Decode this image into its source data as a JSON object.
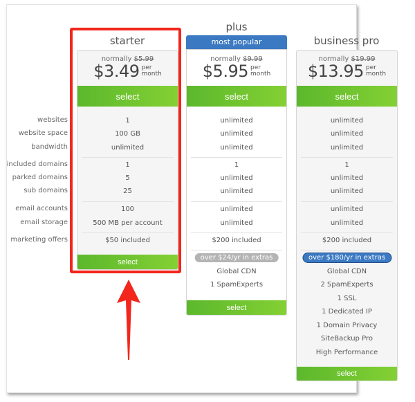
{
  "feature_labels": [
    "websites",
    "website space",
    "bandwidth",
    "included domains",
    "parked domains",
    "sub domains",
    "email accounts",
    "email storage",
    "marketing offers"
  ],
  "plans": [
    {
      "name": "starter",
      "badge": "",
      "normally_label": "normally",
      "old_price": "$5.99",
      "price": "$3.49",
      "per": "per",
      "period": "month",
      "select_label": "select",
      "features": [
        "1",
        "100 GB",
        "unlimited",
        "1",
        "5",
        "25",
        "100",
        "500 MB per account",
        "$50 included"
      ],
      "extras_pill": "",
      "extras": []
    },
    {
      "name": "plus",
      "badge": "most popular",
      "normally_label": "normally",
      "old_price": "$9.99",
      "price": "$5.95",
      "per": "per",
      "period": "month",
      "select_label": "select",
      "features": [
        "unlimited",
        "unlimited",
        "unlimited",
        "1",
        "unlimited",
        "unlimited",
        "unlimited",
        "unlimited",
        "$200 included"
      ],
      "extras_pill": "over $24/yr in extras",
      "extras": [
        "Global CDN",
        "1 SpamExperts"
      ]
    },
    {
      "name": "business pro",
      "badge": "",
      "normally_label": "normally",
      "old_price": "$19.99",
      "price": "$13.95",
      "per": "per",
      "period": "month",
      "select_label": "select",
      "features": [
        "unlimited",
        "unlimited",
        "unlimited",
        "1",
        "unlimited",
        "unlimited",
        "unlimited",
        "unlimited",
        "$200 included"
      ],
      "extras_pill": "over $180/yr in extras",
      "extras": [
        "Global CDN",
        "2 SpamExperts",
        "1 SSL",
        "1 Dedicated IP",
        "1 Domain Privacy",
        "SiteBackup Pro",
        "High Performance"
      ]
    }
  ],
  "colors": {
    "select_green": "#6cc12f",
    "badge_blue": "#3b79c3",
    "pill_grey": "#b4b4b4",
    "annotation_red": "#f2261c"
  }
}
